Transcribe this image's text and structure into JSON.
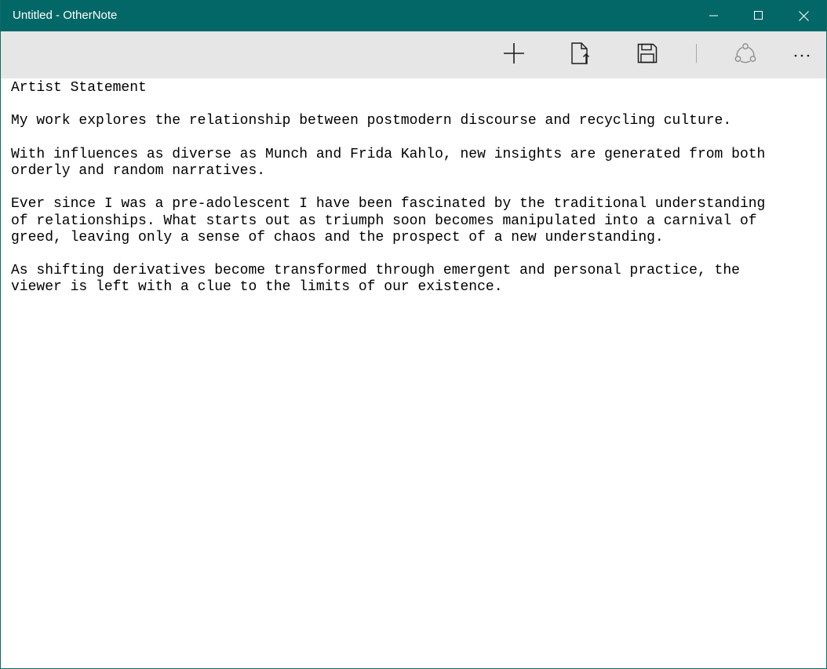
{
  "window": {
    "title": "Untitled - OtherNote",
    "accent_color": "#026766"
  },
  "titlebar_buttons": {
    "minimize_icon": "minimize-icon",
    "maximize_icon": "maximize-icon",
    "close_icon": "close-icon"
  },
  "toolbar": {
    "background": "#e6e6e6",
    "buttons": [
      {
        "name": "new-note",
        "icon": "plus-icon"
      },
      {
        "name": "open-file",
        "icon": "open-file-icon"
      },
      {
        "name": "save",
        "icon": "floppy-disk-icon"
      },
      {
        "name": "share",
        "icon": "share-icon"
      },
      {
        "name": "more",
        "icon": "more-ellipsis-icon",
        "label": "···"
      }
    ]
  },
  "editor": {
    "content": "Artist Statement\n\nMy work explores the relationship between postmodern discourse and recycling culture.\n\nWith influences as diverse as Munch and Frida Kahlo, new insights are generated from both\norderly and random narratives.\n\nEver since I was a pre-adolescent I have been fascinated by the traditional understanding\nof relationships. What starts out as triumph soon becomes manipulated into a carnival of\ngreed, leaving only a sense of chaos and the prospect of a new understanding.\n\nAs shifting derivatives become transformed through emergent and personal practice, the\nviewer is left with a clue to the limits of our existence."
  }
}
